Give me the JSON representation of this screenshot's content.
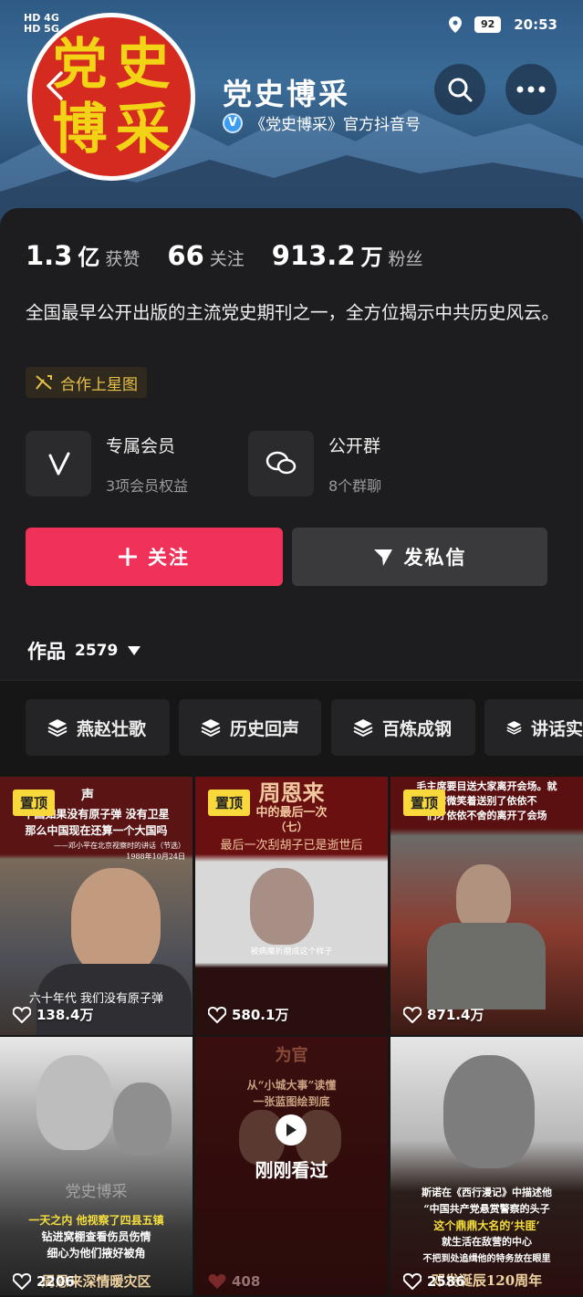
{
  "status_bar": {
    "left_line1": "HD 4G",
    "left_line2": "HD 5G",
    "battery": "92",
    "time": "20:53"
  },
  "profile": {
    "avatar_chars": [
      "党",
      "史",
      "博",
      "采"
    ],
    "name": "党史博采",
    "verified_text": "《党史博采》官方抖音号",
    "stats": [
      {
        "num": "1.3",
        "unit": "亿",
        "label": "获赞"
      },
      {
        "num": "66",
        "unit": "",
        "label": "关注"
      },
      {
        "num": "913.2",
        "unit": "万",
        "label": "粉丝"
      }
    ],
    "bio": "全国最早公开出版的主流党史期刊之一，全方位揭示中共历史风云。",
    "coop_tag": "合作上星图",
    "features": [
      {
        "title": "专属会员",
        "sub": "3项会员权益"
      },
      {
        "title": "公开群",
        "sub": "8个群聊"
      }
    ],
    "follow_label": "关注",
    "message_label": "发私信",
    "works_label": "作品",
    "works_count": "2579"
  },
  "collections": [
    "燕赵壮歌",
    "历史回声",
    "百炼成钢",
    "讲话实"
  ],
  "videos": [
    {
      "pinned": true,
      "pin_label": "置顶",
      "likes": "138.4万",
      "top": "声",
      "line1": "中国如果没有原子弹 没有卫星",
      "line2": "那么中国现在还算一个大国吗",
      "sub": "——邓小平在北京视察时的讲话（节选）",
      "date": "1988年10月24日",
      "caption": "六十年代 我们没有原子弹"
    },
    {
      "pinned": true,
      "pin_label": "置顶",
      "likes": "580.1万",
      "top": "周恩来",
      "line1": "中的最后一次",
      "line2": "（七）",
      "sub": "最后一次刮胡子已是逝世后",
      "caption": "被病魔折磨成这个样子"
    },
    {
      "pinned": true,
      "pin_label": "置顶",
      "likes": "871.4万",
      "line1": "毛主席要目送大家离开会场。就",
      "line2": "席微笑着送别了依依不",
      "sub": "们才依依不舍的离开了会场"
    },
    {
      "pinned": false,
      "likes": "2206",
      "line1": "一天之内 他视察了四县五镇",
      "line2": "钻进窝棚查看伤员伤情",
      "sub": "细心为他们掖好被角",
      "bottom": "周恩来深情暖灾区",
      "brand": "党史博采"
    },
    {
      "pinned": false,
      "likes": "408",
      "top": "为官",
      "line1": "从“小城大事”读懂",
      "line2": "一张蓝图绘到底",
      "watched": "刚刚看过"
    },
    {
      "pinned": false,
      "likes": "2586",
      "line1": "斯诺在《西行漫记》中描述他",
      "line2": "“中国共产党悬赏警察的头子",
      "sub": "这个鼎鼎大名的‘共匪’",
      "sub2": "就生活在敌营的中心",
      "sub3": "不把到处追缉他的特务放在眼里",
      "bottom": "邓发诞辰120周年"
    }
  ]
}
